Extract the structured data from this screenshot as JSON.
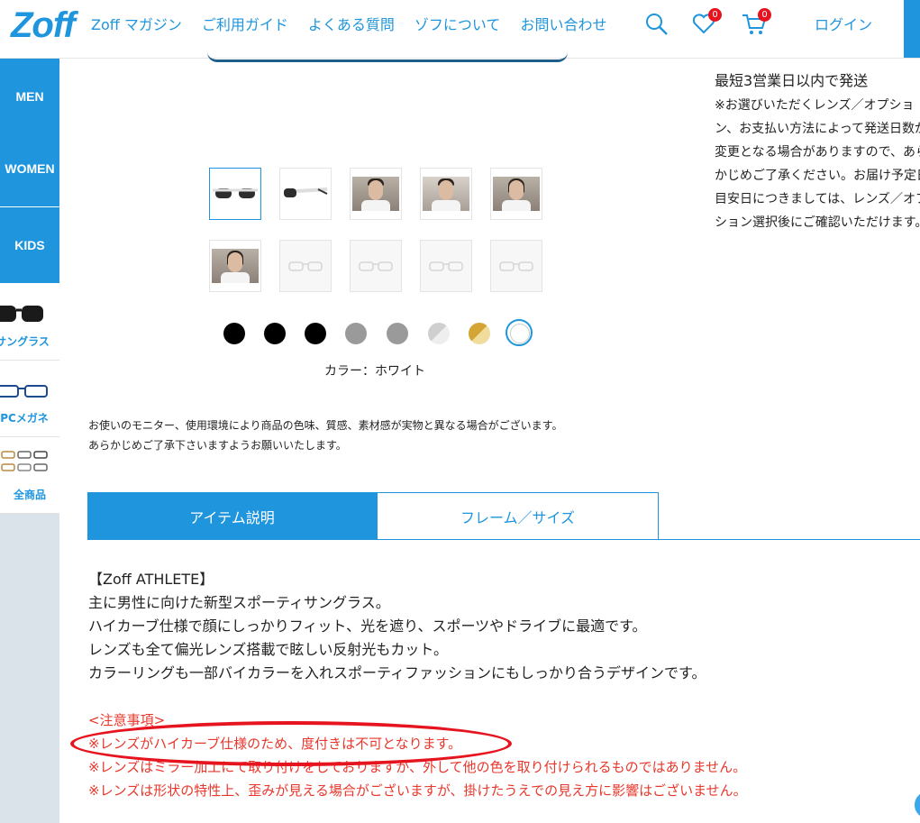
{
  "header": {
    "logo": "Zoff",
    "nav": [
      "Zoff マガジン",
      "ご利用ガイド",
      "よくある質問",
      "ゾフについて",
      "お問い合わせ"
    ],
    "favorites_count": "0",
    "cart_count": "0",
    "login_label": "ログイン",
    "icons": [
      "search-icon",
      "heart-icon",
      "cart-icon"
    ]
  },
  "sidebar": {
    "genders": [
      "MEN",
      "WOMEN",
      "KIDS"
    ],
    "categories": [
      "サングラス",
      "PCメガネ",
      "全商品"
    ]
  },
  "shipping": {
    "title": "最短3営業日以内で発送",
    "text": "※お選びいただくレンズ／オプション、お支払い方法によって発送日数が変更となる場合がありますので、あらかじめご了承ください。お届け予定日目安日につきましては、レンズ／オプション選択後にご確認いただけます。"
  },
  "colors": {
    "swatches": [
      "#000000",
      "#000000",
      "#000000",
      "#9a9a9a",
      "#9a9a9a",
      "#cfcfcf",
      "#d4a434",
      "#ffffff"
    ],
    "selected_label": "カラー：ホワイト"
  },
  "notice": {
    "line1": "お使いのモニター、使用環境により商品の色味、質感、素材感が実物と異なる場合がございます。",
    "line2": "あらかじめご了承下さいますようお願いいたします。"
  },
  "tabs": {
    "active": "アイテム説明",
    "other": "フレーム／サイズ"
  },
  "description": {
    "l1": "【Zoff ATHLETE】",
    "l2": "主に男性に向けた新型スポーティサングラス。",
    "l3": "ハイカーブ仕様で顔にしっかりフィット、光を遮り、スポーツやドライブに最適です。",
    "l4": "レンズも全て偏光レンズ搭載で眩しい反射光もカット。",
    "l5": "カラーリングも一部バイカラーを入れスポーティファッションにもしっかり合うデザインです。"
  },
  "caution": {
    "heading": "<注意事項>",
    "c1": "※レンズがハイカーブ仕様のため、度付きは不可となります。",
    "c2": "※レンズはミラー加工にて取り付けをしておりますが、外して他の色を取り付けられるものではありません。",
    "c3": "※レンズは形状の特性上、歪みが見える場合がございますが、掛けたうえでの見え方に影響はございません。"
  }
}
